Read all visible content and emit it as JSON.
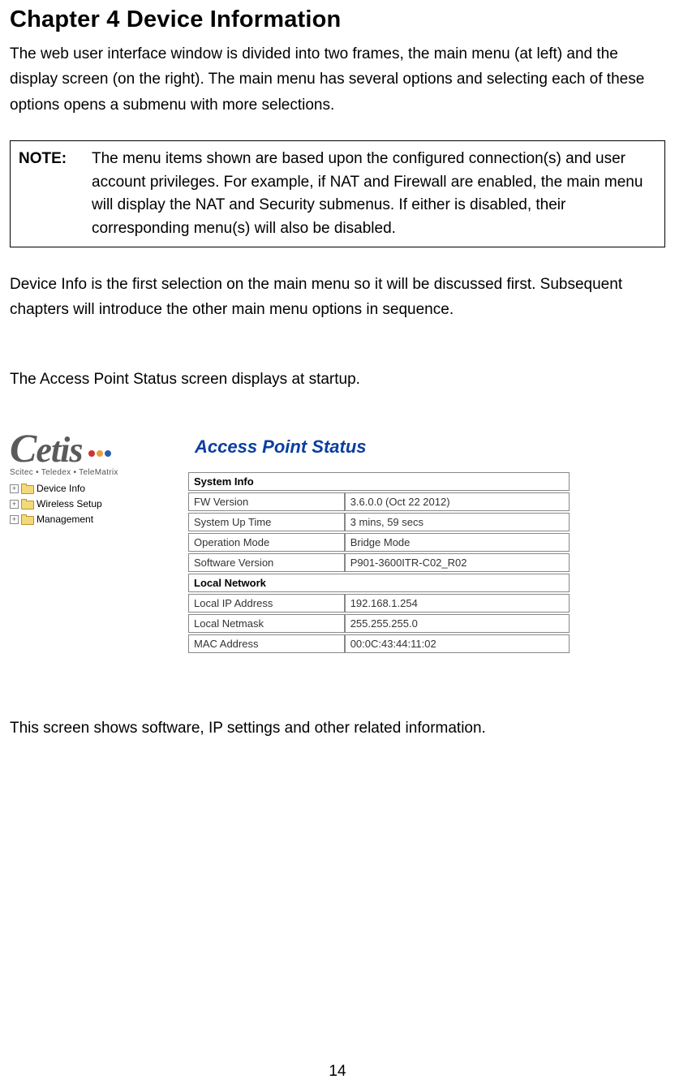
{
  "chapter_title": "Chapter 4 Device Information",
  "intro": "The web user interface window is divided into two frames, the main menu (at left) and the display screen (on the right). The main menu has several options and selecting each of these options opens a submenu with more selections.",
  "note_label": "NOTE:",
  "note_body": "The menu items shown are based upon the configured connection(s) and user account privileges. For example, if NAT and Firewall are enabled, the main menu will display the NAT and Security submenus. If either is disabled, their corresponding menu(s) will also be disabled.",
  "para2": "Device Info is the first selection on the main menu so it will be discussed first.  Subsequent chapters will introduce the other main menu options in sequence.",
  "para3": "The Access Point Status screen displays at startup.",
  "logo": {
    "brand": "Cetis",
    "tagline": "Scitec • Teledex • TeleMatrix"
  },
  "tree": [
    "Device Info",
    "Wireless Setup",
    "Management"
  ],
  "panel_title": "Access Point Status",
  "table": {
    "section1": "System Info",
    "rows1": [
      {
        "k": "FW Version",
        "v": "3.6.0.0 (Oct 22 2012)"
      },
      {
        "k": "System Up Time",
        "v": "3 mins, 59 secs"
      },
      {
        "k": "Operation Mode",
        "v": "Bridge Mode"
      },
      {
        "k": "Software Version",
        "v": "P901-3600ITR-C02_R02"
      }
    ],
    "section2": "Local Network",
    "rows2": [
      {
        "k": "Local IP Address",
        "v": "192.168.1.254"
      },
      {
        "k": "Local Netmask",
        "v": "255.255.255.0"
      },
      {
        "k": "MAC Address",
        "v": "00:0C:43:44:11:02"
      }
    ]
  },
  "closing": "This screen shows software, IP settings and other related information.",
  "page_number": "14"
}
